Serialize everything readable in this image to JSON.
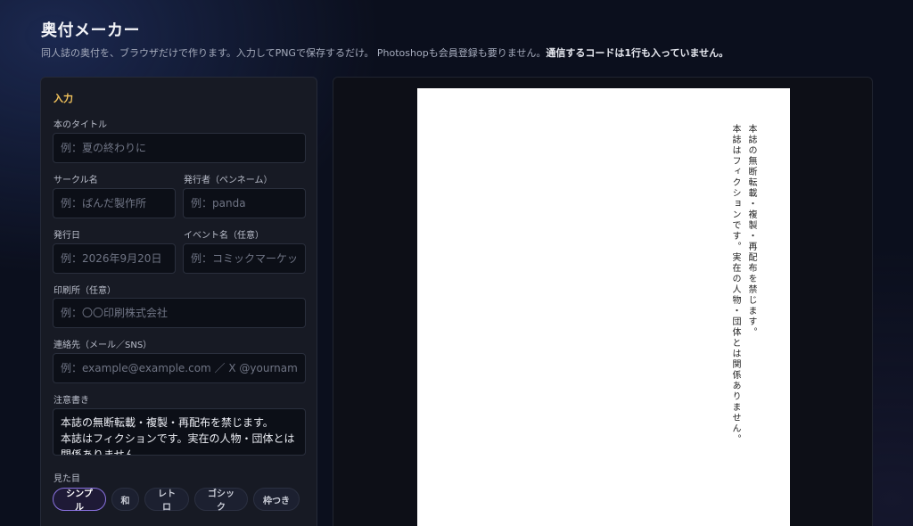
{
  "header": {
    "title": "奥付メーカー",
    "subtitle_normal": "同人誌の奥付を、ブラウザだけで作ります。入力してPNGで保存するだけ。 Photoshopも会員登録も要りません。",
    "subtitle_bold": "通信するコードは1行も入っていません。"
  },
  "form": {
    "section_title": "入力",
    "book_title": {
      "label": "本のタイトル",
      "placeholder": "例：夏の終わりに"
    },
    "circle": {
      "label": "サークル名",
      "placeholder": "例：ぱんだ製作所"
    },
    "publisher": {
      "label": "発行者（ペンネーム）",
      "placeholder": "例：panda"
    },
    "date": {
      "label": "発行日",
      "placeholder": "例：2026年9月20日"
    },
    "event": {
      "label": "イベント名（任意）",
      "placeholder": "例：コミックマーケット"
    },
    "printer": {
      "label": "印刷所（任意）",
      "placeholder": "例：〇〇印刷株式会社"
    },
    "contact": {
      "label": "連絡先（メール／SNS）",
      "placeholder": "例：example@example.com ／ X @yourname"
    },
    "notes": {
      "label": "注意書き",
      "value": "本誌の無断転載・複製・再配布を禁じます。\n本誌はフィクションです。実在の人物・団体とは関係ありません。"
    },
    "style": {
      "label": "見た目",
      "options": [
        "シンプル",
        "和",
        "レトロ",
        "ゴシック",
        "枠つき"
      ],
      "selected": "シンプル"
    }
  },
  "preview": {
    "notes_lines": [
      "本誌の無断転載・複製・再配布を禁じます。",
      "本誌はフィクションです。実在の人物・団体とは関係ありません。"
    ]
  },
  "colors": {
    "accent": "#f3c35c",
    "selected_border": "#8a72e0",
    "background": "#0b0f1d"
  }
}
